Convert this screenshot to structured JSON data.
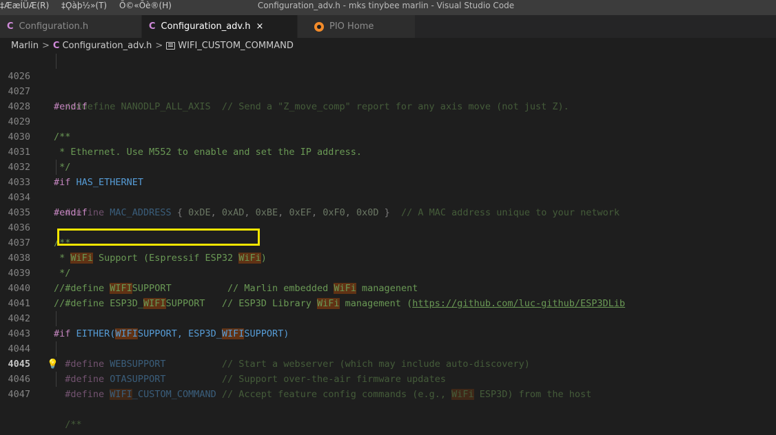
{
  "titlebar": {
    "menus": [
      "‡ÆæÍÜÆ(R)",
      "‡Ǫàþ½»(T)",
      "Õ©«Õè®(H)"
    ],
    "window_title": "Configuration_adv.h - mks tinybee marlin - Visual Studio Code"
  },
  "tabs": [
    {
      "label": "Configuration.h",
      "icon": "c-file-icon",
      "active": false
    },
    {
      "label": "Configuration_adv.h",
      "icon": "c-file-icon",
      "active": true,
      "close": "×"
    },
    {
      "label": "PIO Home",
      "icon": "platformio-icon",
      "active": false
    }
  ],
  "breadcrumb": {
    "folder": "Marlin",
    "file": "Configuration_adv.h",
    "symbol": "WIFI_CUSTOM_COMMAND",
    "separator": ">"
  },
  "icons": {
    "c_file": "C"
  },
  "colors": {
    "highlight_box": "#f5e600",
    "search_match": "#613214"
  },
  "lines": [
    {
      "no": "4026",
      "a": "  //#define NANODLP_ALL_AXIS  // Send a \"Z_move_comp\" report for any axis move (not just Z)."
    },
    {
      "no": "4027",
      "a": "#endif"
    },
    {
      "no": "4028"
    },
    {
      "no": "4029",
      "a": "/**"
    },
    {
      "no": "4030",
      "a": " * Ethernet. Use M552 to enable and set the IP address."
    },
    {
      "no": "4031",
      "a": " */"
    },
    {
      "no": "4032",
      "a": "#if",
      "b": " HAS_ETHERNET"
    },
    {
      "no": "4033",
      "a": "  #define",
      "b": " MAC_ADDRESS",
      "c": " { ",
      "d": "0xDE",
      "e": ", ",
      "f": "0xAD",
      "g": ", ",
      "h": "0xBE",
      "i": ", ",
      "j": "0xEF",
      "k": ", ",
      "l": "0xF0",
      "m": ", ",
      "n": "0x0D",
      "o": " } ",
      "p": " // A MAC address unique to your network"
    },
    {
      "no": "4034",
      "a": "#endif"
    },
    {
      "no": "4035"
    },
    {
      "no": "4036",
      "a": "/**"
    },
    {
      "no": "4037",
      "a": " * ",
      "b": "WiFi",
      "c": " Support (Espressif ESP32 ",
      "d": "WiFi",
      "e": ")"
    },
    {
      "no": "4038",
      "a": " */"
    },
    {
      "no": "4039",
      "a": "//#define ",
      "b": "WIFI",
      "c": "SUPPORT          // Marlin embedded ",
      "d": "WiFi",
      "e": " managenent"
    },
    {
      "no": "4040",
      "a": "//#define ESP3D_",
      "b": "WIFI",
      "c": "SUPPORT   // ESP3D Library ",
      "d": "WiFi",
      "e": " management (",
      "f": "https://github.com/luc-github/ESP3DLib"
    },
    {
      "no": "4041"
    },
    {
      "no": "4042",
      "a": "#if",
      "b": " EITHER(",
      "c": "WIFI",
      "d": "SUPPORT, ESP3D_",
      "e": "WIFI",
      "f": "SUPPORT)"
    },
    {
      "no": "4043",
      "a": "  #define",
      "b": " WEBSUPPORT",
      "c": "          // Start a webserver (which may include auto-discovery)"
    },
    {
      "no": "4044",
      "a": "  #define",
      "b": " OTASUPPORT",
      "c": "          // Support over-the-air firmware updates"
    },
    {
      "no": "4045",
      "a": "  #define",
      "b": " ",
      "c": "WIFI",
      "d": "_CUSTOM_COMMAND",
      "e": " // Accept feature config commands (e.g., ",
      "f": "WiFi",
      "g": " ESP3D) from the host"
    },
    {
      "no": "4046"
    },
    {
      "no": "4047",
      "a": "  /**"
    }
  ]
}
